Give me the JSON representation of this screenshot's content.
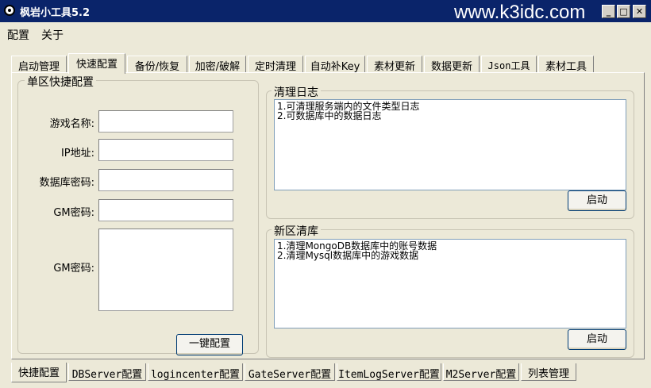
{
  "window": {
    "title": "枫岩小工具5.2",
    "watermark": "www.k3idc.com",
    "controls": {
      "minimize": "_",
      "maximize": "□",
      "close": "✕"
    }
  },
  "menu": [
    "配置",
    "关于"
  ],
  "tabs_top": [
    {
      "label": "启动管理",
      "active": false
    },
    {
      "label": "快速配置",
      "active": true
    },
    {
      "label": "备份/恢复",
      "active": false
    },
    {
      "label": "加密/破解",
      "active": false
    },
    {
      "label": "定时清理",
      "active": false
    },
    {
      "label": "自动补Key",
      "active": false
    },
    {
      "label": "素材更新",
      "active": false
    },
    {
      "label": "数据更新",
      "active": false
    },
    {
      "label": "Json工具",
      "active": false
    },
    {
      "label": "素材工具",
      "active": false
    }
  ],
  "single_config": {
    "title": "单区快捷配置",
    "fields": [
      {
        "label": "游戏名称:",
        "value": ""
      },
      {
        "label": "IP地址:",
        "value": ""
      },
      {
        "label": "数据库密码:",
        "value": ""
      },
      {
        "label": "GM密码:",
        "value": ""
      },
      {
        "label": "GM密码:",
        "value": ""
      }
    ],
    "button": "一键配置"
  },
  "clear_log": {
    "title": "清理日志",
    "lines": [
      "1.可清理服务端内的文件类型日志",
      "2.可数据库中的数据日志"
    ],
    "button": "启动"
  },
  "new_zone": {
    "title": "新区清库",
    "lines": [
      "1.清理MongoDB数据库中的账号数据",
      "2.清理Mysql数据库中的游戏数据"
    ],
    "button": "启动"
  },
  "tabs_bottom": [
    {
      "label": "快捷配置",
      "active": true
    },
    {
      "label": "DBServer配置",
      "active": false
    },
    {
      "label": "logincenter配置",
      "active": false
    },
    {
      "label": "GateServer配置",
      "active": false
    },
    {
      "label": "ItemLogServer配置",
      "active": false
    },
    {
      "label": "M2Server配置",
      "active": false
    },
    {
      "label": "列表管理",
      "active": false
    }
  ]
}
